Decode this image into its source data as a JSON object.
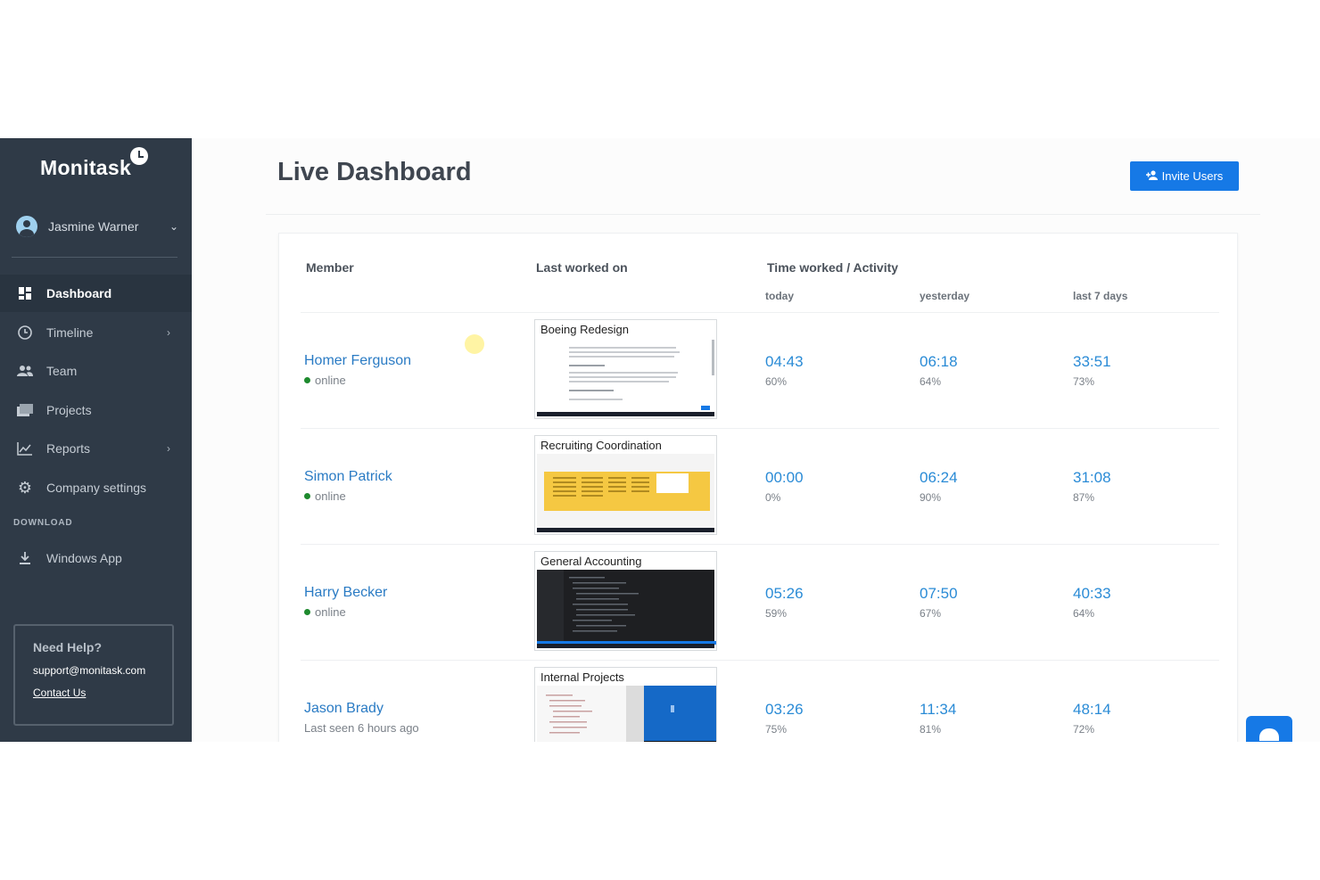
{
  "app": {
    "logo": "Monitask"
  },
  "user": {
    "name": "Jasmine Warner"
  },
  "nav": {
    "items": [
      {
        "label": "Dashboard",
        "icon": "dashboard-icon",
        "active": true,
        "arrow": false
      },
      {
        "label": "Timeline",
        "icon": "clock-icon",
        "active": false,
        "arrow": true
      },
      {
        "label": "Team",
        "icon": "team-icon",
        "active": false,
        "arrow": false
      },
      {
        "label": "Projects",
        "icon": "folder-icon",
        "active": false,
        "arrow": false
      },
      {
        "label": "Reports",
        "icon": "chart-icon",
        "active": false,
        "arrow": true
      },
      {
        "label": "Company settings",
        "icon": "gear-icon",
        "active": false,
        "arrow": false
      }
    ],
    "download_label": "DOWNLOAD",
    "download_item": {
      "label": "Windows App",
      "icon": "download-icon"
    }
  },
  "help": {
    "title": "Need Help?",
    "email": "support@monitask.com",
    "link": "Contact Us"
  },
  "page": {
    "title": "Live Dashboard",
    "invite_label": "Invite Users"
  },
  "table": {
    "headers": {
      "member": "Member",
      "last_worked": "Last worked on",
      "time_activity": "Time worked / Activity",
      "today": "today",
      "yesterday": "yesterday",
      "last7": "last 7 days"
    },
    "rows": [
      {
        "name": "Homer Ferguson",
        "status": "online",
        "online": true,
        "project": "Boeing Redesign",
        "today": "04:43",
        "today_pct": "60%",
        "yesterday": "06:18",
        "yesterday_pct": "64%",
        "last7": "33:51",
        "last7_pct": "73%"
      },
      {
        "name": "Simon Patrick",
        "status": "online",
        "online": true,
        "project": "Recruiting Coordination",
        "today": "00:00",
        "today_pct": "0%",
        "yesterday": "06:24",
        "yesterday_pct": "90%",
        "last7": "31:08",
        "last7_pct": "87%"
      },
      {
        "name": "Harry Becker",
        "status": "online",
        "online": true,
        "project": "General Accounting",
        "today": "05:26",
        "today_pct": "59%",
        "yesterday": "07:50",
        "yesterday_pct": "67%",
        "last7": "40:33",
        "last7_pct": "64%"
      },
      {
        "name": "Jason Brady",
        "status": "Last seen 6 hours ago",
        "online": false,
        "project": "Internal Projects",
        "today": "03:26",
        "today_pct": "75%",
        "yesterday": "11:34",
        "yesterday_pct": "81%",
        "last7": "48:14",
        "last7_pct": "72%"
      }
    ]
  },
  "colors": {
    "sidebar": "#2f3a47",
    "accent": "#1679e6",
    "link": "#2a7bc4",
    "online": "#1e8a2e"
  }
}
